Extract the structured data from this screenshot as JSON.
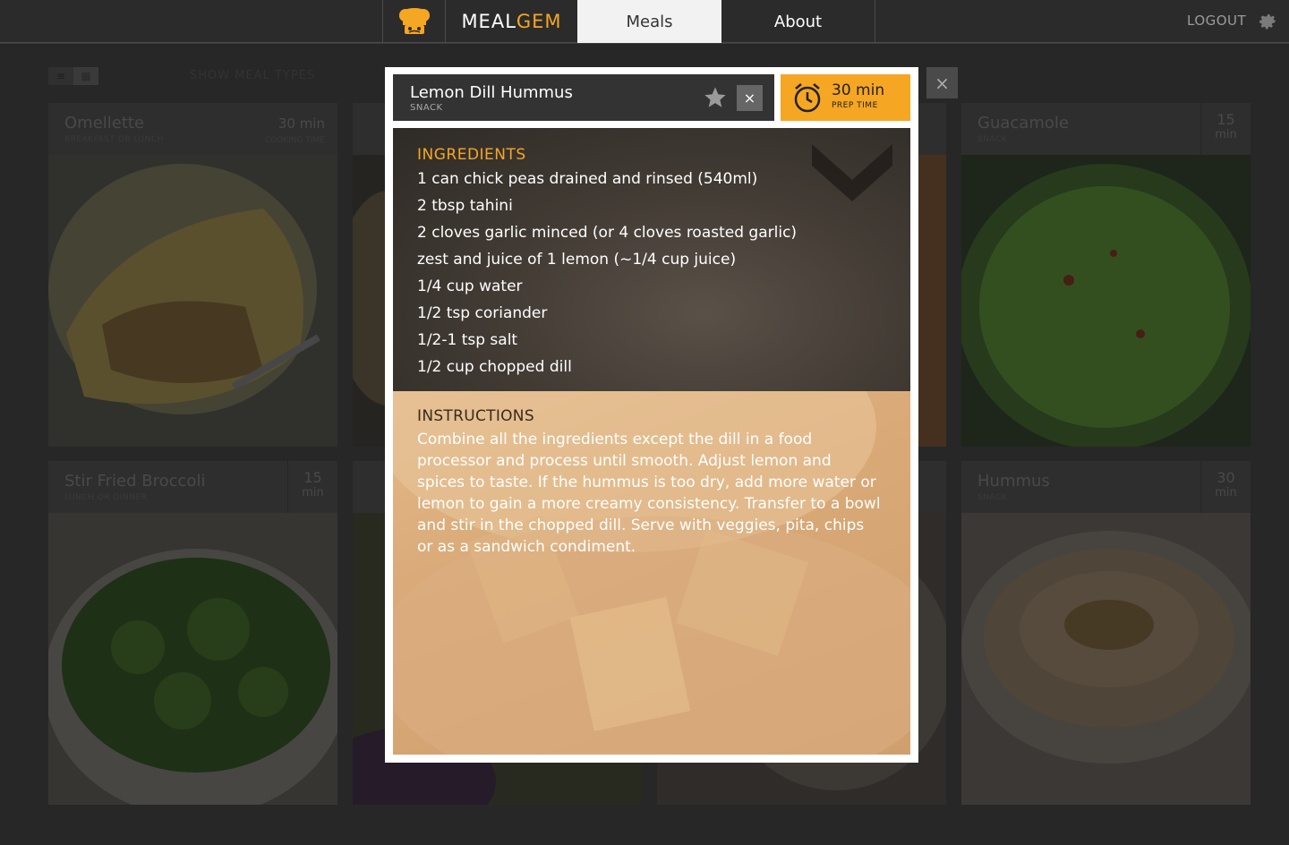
{
  "header": {
    "brand_part1": "MEAL",
    "brand_part2": "GEM",
    "tabs": [
      "Meals",
      "About"
    ],
    "logout_label": "LOGOUT",
    "accent_color": "#f5a623"
  },
  "toolbar": {
    "show_meal_types_label": "SHOW MEAL TYPES"
  },
  "cards": [
    {
      "title": "Omellette",
      "type": "BREAKFAST OR LUNCH",
      "time": "30 min",
      "time_label": "COOKING TIME"
    },
    {
      "title": "Guacamole",
      "type": "SNACK",
      "time": "15",
      "time_unit": "min"
    },
    {
      "title": "Stir Fried Broccoli",
      "type": "LUNCH OR DINNER",
      "time": "15",
      "time_unit": "min"
    },
    {
      "title": "Hummus",
      "type": "SNACK",
      "time": "30",
      "time_unit": "min"
    }
  ],
  "modal": {
    "title": "Lemon Dill Hummus",
    "type": "SNACK",
    "close_symbol": "×",
    "prep_time": "30 min",
    "prep_label": "PREP TIME",
    "ingredients_title": "INGREDIENTS",
    "ingredients": [
      "1 can chick peas drained and rinsed (540ml)",
      "2 tbsp tahini",
      "2 cloves garlic minced (or 4 cloves roasted garlic)",
      "zest and juice of 1 lemon (~1/4 cup juice)",
      "1/4 cup water",
      "1/2 tsp coriander",
      "1/2-1 tsp salt",
      "1/2 cup chopped dill"
    ],
    "instructions_title": "INSTRUCTIONS",
    "instructions": "Combine all the ingredients except the dill in a food processor and process until smooth. Adjust lemon and spices to taste. If the hummus is too dry, add more water or lemon to gain a more creamy consistency. Transfer to a bowl and stir in the chopped dill. Serve with veggies, pita, chips or as a sandwich condiment."
  },
  "icons": {
    "logo": "chef-hat-icon",
    "settings": "gear-icon",
    "favorite": "star-icon",
    "clock": "alarm-clock-icon",
    "close": "close-icon"
  }
}
